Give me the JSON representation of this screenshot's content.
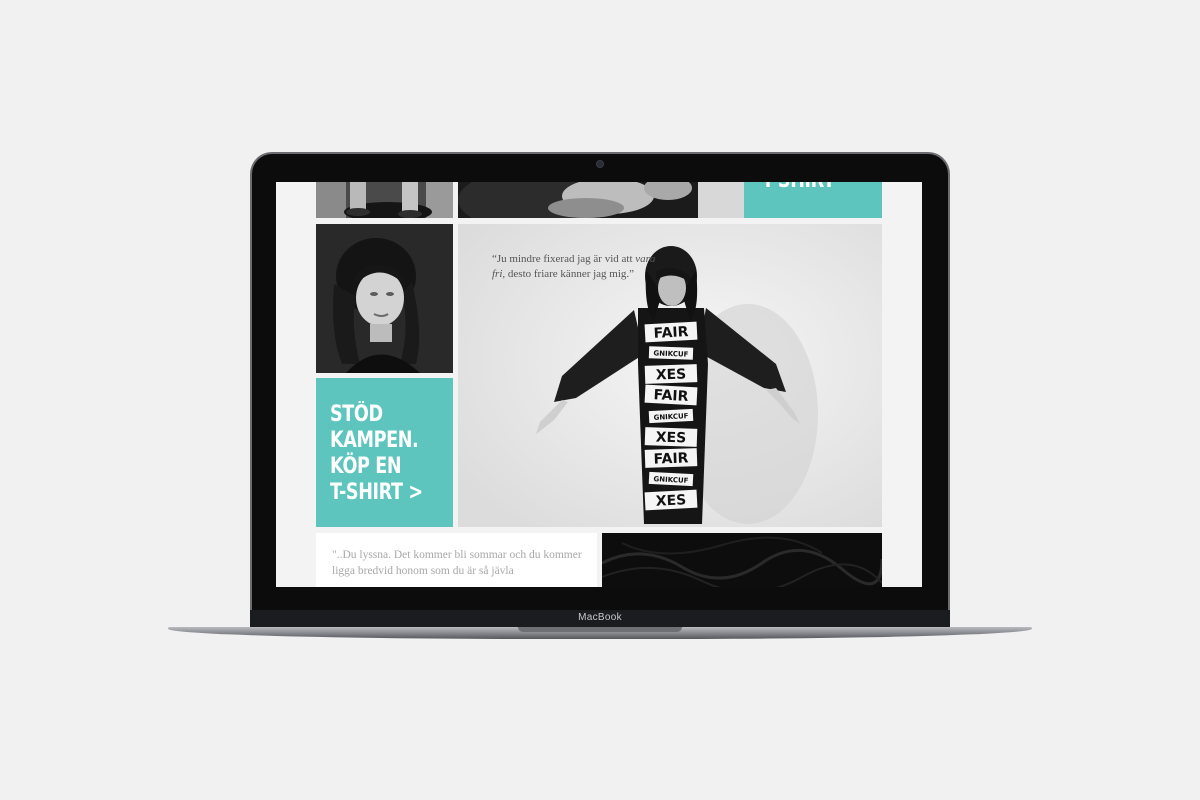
{
  "device": {
    "brand_label": "MacBook"
  },
  "page": {
    "promo_top": {
      "text": "T-SHIRT"
    },
    "cta": {
      "lines": [
        "STÖD",
        "KAMPEN.",
        "KÖP EN",
        "T-SHIRT >"
      ]
    },
    "hero": {
      "quote_part1": "“Ju mindre fixerad jag är vid att ",
      "quote_emphasis": "vara fri",
      "quote_part2": ", desto friare känner jag mig.”",
      "shirt_words": [
        "FAIR",
        "GNIKCUF",
        "XES",
        "FAIR",
        "GNIKCUF",
        "XES",
        "FAIR",
        "GNIKCUF",
        "XES"
      ]
    },
    "quote2": {
      "text": "\"..Du lyssna. Det kommer bli sommar och du kommer ligga bredvid honom som du är så jävla"
    }
  },
  "colors": {
    "teal_accent": "#5ec5be",
    "page_background": "#f3f3f3",
    "bezel": "#0c0c0d"
  }
}
